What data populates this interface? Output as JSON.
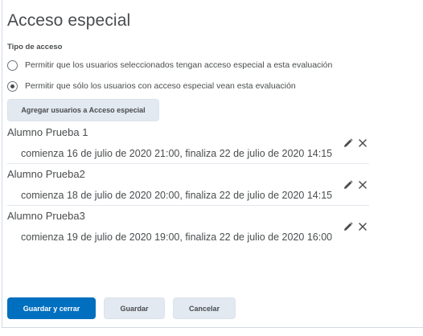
{
  "dialog": {
    "title": "Acceso especial"
  },
  "access_type": {
    "label": "Tipo de acceso",
    "options": [
      {
        "label": "Permitir que los usuarios seleccionados tengan acceso especial a esta evaluación",
        "selected": false
      },
      {
        "label": "Permitir que sólo los usuarios con acceso especial vean esta evaluación",
        "selected": true
      }
    ]
  },
  "add_button_label": "Agregar usuarios a Acceso especial",
  "entries": [
    {
      "name": "Alumno Prueba 1",
      "dates": "comienza 16 de julio de 2020 21:00, finaliza 22 de julio de 2020 14:15"
    },
    {
      "name": "Alumno Prueba2",
      "dates": "comienza 18 de julio de 2020 20:00, finaliza 22 de julio de 2020 14:15"
    },
    {
      "name": "Alumno Prueba3",
      "dates": "comienza 19 de julio de 2020 19:00, finaliza 22 de julio de 2020 16:00"
    }
  ],
  "entry_icons": {
    "edit": "pencil-icon",
    "remove": "close-icon"
  },
  "footer": {
    "save_close_label": "Guardar y cerrar",
    "save_label": "Guardar",
    "cancel_label": "Cancelar"
  },
  "colors": {
    "primary": "#006fbf",
    "secondary_button": "#e3e9f1",
    "text": "#494c4e"
  }
}
